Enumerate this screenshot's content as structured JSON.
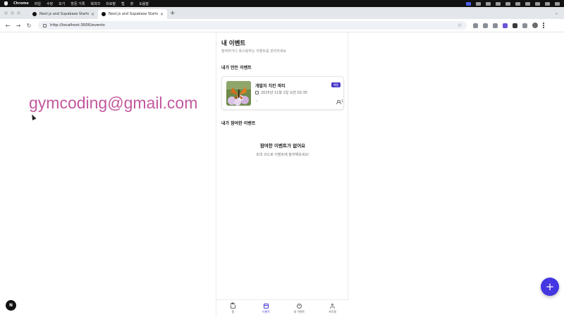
{
  "menubar": {
    "app": "Chrome",
    "items": [
      "파일",
      "수정",
      "보기",
      "방문 기록",
      "북마크",
      "프로필",
      "탭",
      "창",
      "도움말"
    ],
    "clock": ""
  },
  "tabs": [
    {
      "label": "Next.js and Supabase Starter",
      "close": "×"
    },
    {
      "label": "Next.js and Supabase Starter",
      "close": "×"
    }
  ],
  "tabstrip": {
    "new_tab": "+",
    "expand": "⌄"
  },
  "toolbar": {
    "back": "←",
    "forward": "→",
    "reload": "↻",
    "url": "http://localhost:3000/events",
    "star": "☆"
  },
  "overlay": {
    "email": "gymcoding@gmail.com"
  },
  "events_page": {
    "title": "내 이벤트",
    "subtitle": "참여하거나 호스팅하는 이벤트를 관리하세요",
    "hosted_section": "내가 만든 이벤트",
    "joined_section": "내가 참여한 이벤트",
    "card": {
      "name": "개발자 치킨 파티",
      "date": "2025년 11월 1일 오전 02:35",
      "badge": "예정",
      "attendees": "1",
      "share": "↗"
    },
    "empty_title": "참여한 이벤트가 없어요",
    "empty_desc": "초대 코드로 이벤트에 참여해보세요!"
  },
  "bottom_nav": [
    {
      "label": "홈",
      "icon": "home-icon",
      "active": false
    },
    {
      "label": "이벤트",
      "icon": "calendar-icon",
      "active": true
    },
    {
      "label": "새 이벤트",
      "icon": "plus-circle-icon",
      "active": false
    },
    {
      "label": "프로필",
      "icon": "user-icon",
      "active": false
    }
  ],
  "fab": {
    "label": "+"
  },
  "dev_badge": {
    "label": "N"
  },
  "colors": {
    "accent": "#4436e0",
    "overlay_text": "#c3589e",
    "badge": "#4638c9"
  }
}
